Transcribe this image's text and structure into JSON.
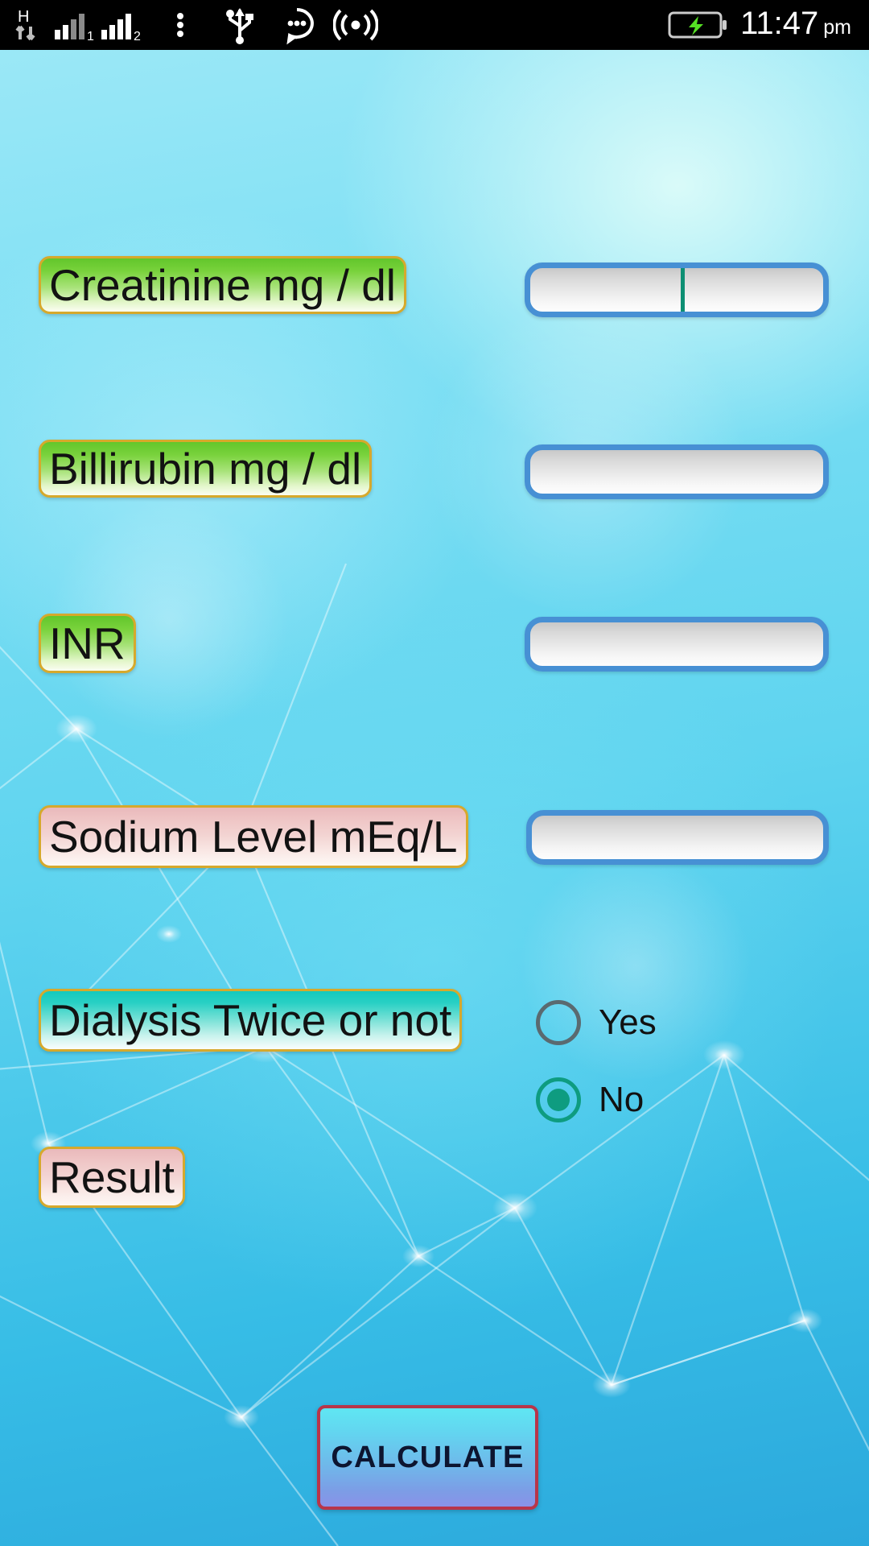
{
  "status_bar": {
    "network_type": "H",
    "data_arrows_icon": "data-transfer-arrows-icon",
    "sim1_signal_icon": "signal-bars-sim1-icon",
    "sim1_label": "1",
    "sim2_signal_icon": "signal-bars-sim2-icon",
    "sim2_label": "2",
    "more_icon": "overflow-menu-icon",
    "usb_icon": "usb-icon",
    "message_icon": "message-bubble-icon",
    "broadcast_icon": "wireless-broadcast-icon",
    "battery_icon": "battery-charging-icon",
    "time": "11:47",
    "ampm": "pm",
    "background_color": "#000000",
    "text_color": "#ffffff",
    "battery_bolt_color": "#55e024"
  },
  "theme": {
    "page_background_top": "#9fe9f7",
    "page_background_bottom": "#2ba8dc",
    "label_border": "#d6a92c",
    "label_green": "#62c62b",
    "label_pink": "#e9b9bb",
    "label_teal": "#14c9bd",
    "input_border": "#4790d4",
    "caret_color": "#0d8f73",
    "radio_checked": "#0e9c80",
    "radio_unchecked": "#5a6a70",
    "button_border": "#b8354a",
    "button_gradient_top": "#5fe6f2",
    "button_gradient_bottom": "#8a92e8"
  },
  "form": {
    "fields": [
      {
        "id": "creatinine",
        "label": "Creatinine mg / dl",
        "label_style": "green",
        "input_value": "",
        "focused": true
      },
      {
        "id": "billirubin",
        "label": "Billirubin mg / dl",
        "label_style": "green",
        "input_value": "",
        "focused": false
      },
      {
        "id": "inr",
        "label": "INR",
        "label_style": "green",
        "input_value": "",
        "focused": false
      },
      {
        "id": "sodium",
        "label": "Sodium Level mEq/L",
        "label_style": "pink",
        "input_value": "",
        "focused": false
      }
    ],
    "dialysis": {
      "label": "Dialysis Twice or not",
      "label_style": "teal",
      "options": [
        {
          "label": "Yes",
          "selected": false
        },
        {
          "label": "No",
          "selected": true
        }
      ]
    },
    "result": {
      "label": "Result",
      "label_style": "pink",
      "value": ""
    },
    "calculate_button": {
      "label": "CALCULATE"
    }
  }
}
